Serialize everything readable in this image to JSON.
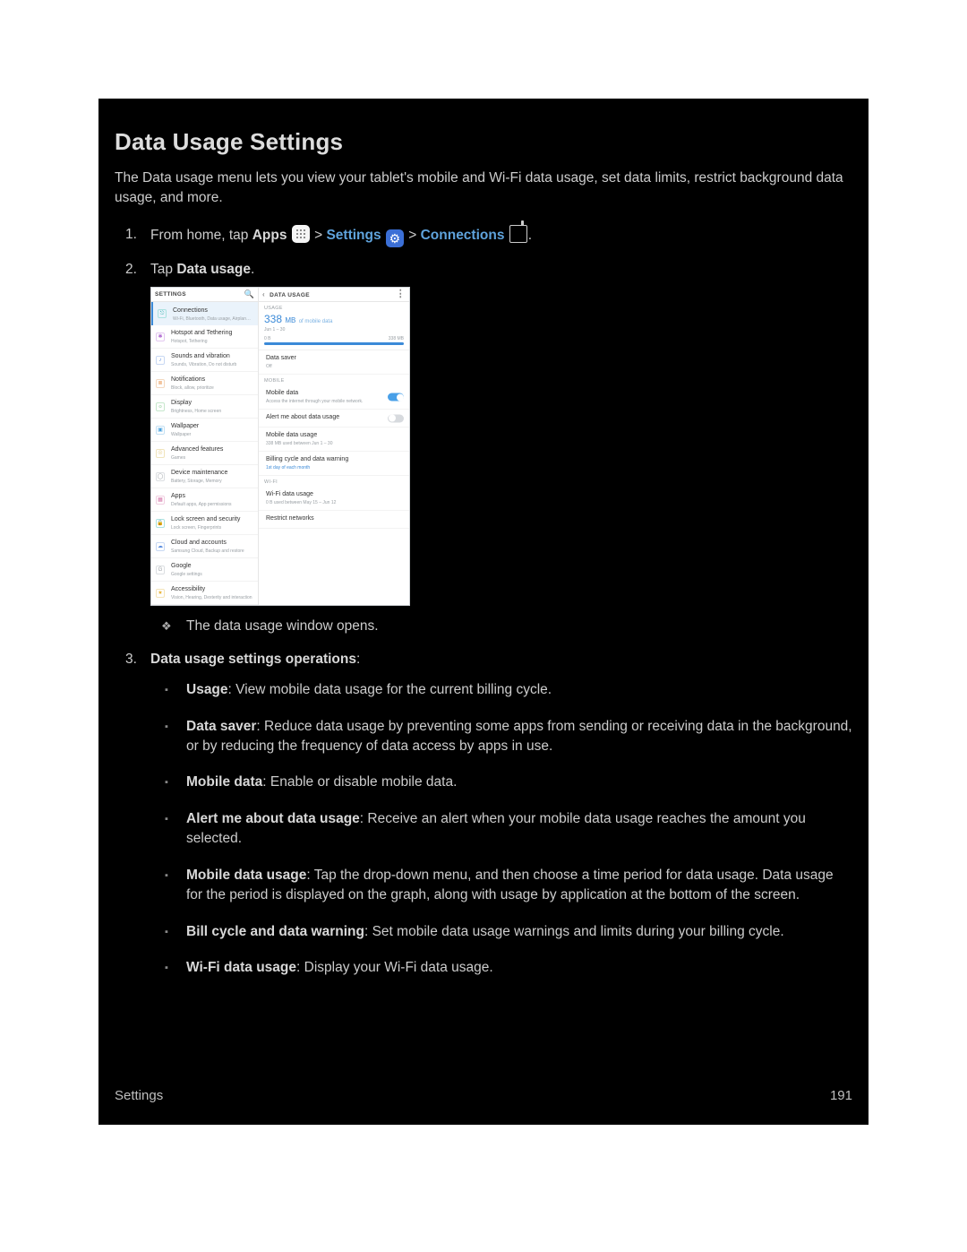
{
  "title": "Data Usage Settings",
  "intro": "The Data usage menu lets you view your tablet's mobile and Wi-Fi data usage, set data limits, restrict background data usage, and more.",
  "steps": {
    "s1": {
      "pre": "From home, tap ",
      "apps": "Apps",
      "settings": "Settings",
      "connections": "Connections",
      "gt": " > "
    },
    "s2": {
      "pre": "Tap ",
      "bold": "Data usage",
      "post": "."
    },
    "resultBullet": "The data usage window opens.",
    "s3": {
      "bold": "Data usage settings operations",
      "post": ":"
    }
  },
  "ops": [
    {
      "b": "Usage",
      "t": ": View mobile data usage for the current billing cycle."
    },
    {
      "b": "Data saver",
      "t": ": Reduce data usage by preventing some apps from sending or receiving data in the background, or by reducing the frequency of data access by apps in use."
    },
    {
      "b": "Mobile data",
      "t": ": Enable or disable mobile data."
    },
    {
      "b": "Alert me about data usage",
      "t": ": Receive an alert when your mobile data usage reaches the amount you selected."
    },
    {
      "b": "Mobile data usage",
      "t": ": Tap the drop-down menu, and then choose a time period for data usage. Data usage for the period is displayed on the graph, along with usage by application at the bottom of the screen."
    },
    {
      "b": "Bill cycle and data warning",
      "t": ": Set mobile data usage warnings and limits during your billing cycle."
    },
    {
      "b": "Wi-Fi data usage",
      "t": ": Display your Wi-Fi data usage."
    }
  ],
  "footer": {
    "left": "Settings",
    "right": "191"
  },
  "shot": {
    "leftHeader": "SETTINGS",
    "rightHeader": "DATA USAGE",
    "leftItems": [
      {
        "t": "Connections",
        "s": "Wi-Fi, Bluetooth, Data usage, Airplane m...",
        "cls": "teal",
        "sel": true,
        "ico": "⎋"
      },
      {
        "t": "Hotspot and Tethering",
        "s": "Hotspot, Tethering",
        "cls": "purple",
        "ico": "✱"
      },
      {
        "t": "Sounds and vibration",
        "s": "Sounds, Vibration, Do not disturb",
        "cls": "blue",
        "ico": "♪"
      },
      {
        "t": "Notifications",
        "s": "Block, allow, prioritize",
        "cls": "orange",
        "ico": "≣"
      },
      {
        "t": "Display",
        "s": "Brightness, Home screen",
        "cls": "green",
        "ico": "☼"
      },
      {
        "t": "Wallpaper",
        "s": "Wallpaper",
        "cls": "cyan",
        "ico": "▣"
      },
      {
        "t": "Advanced features",
        "s": "Games",
        "cls": "gold",
        "ico": "☉"
      },
      {
        "t": "Device maintenance",
        "s": "Battery, Storage, Memory",
        "cls": "gray",
        "ico": "◯"
      },
      {
        "t": "Apps",
        "s": "Default apps, App permissions",
        "cls": "pink",
        "ico": "▦"
      },
      {
        "t": "Lock screen and security",
        "s": "Lock screen, Fingerprints",
        "cls": "teal",
        "ico": "🔒"
      },
      {
        "t": "Cloud and accounts",
        "s": "Samsung Cloud, Backup and restore",
        "cls": "blue",
        "ico": "☁"
      },
      {
        "t": "Google",
        "s": "Google settings",
        "cls": "gray",
        "ico": "G"
      },
      {
        "t": "Accessibility",
        "s": "Vision, Hearing, Dexterity and interaction",
        "cls": "star",
        "ico": "★"
      }
    ],
    "usage": {
      "label": "USAGE",
      "value": "338",
      "unit": "MB",
      "suffix": "of mobile data",
      "period": "Jun 1 – 30",
      "barLeft": "0 B",
      "barRight": "338 MB"
    },
    "rightItems": [
      {
        "t": "Data saver",
        "s": "Off",
        "toggle": null
      },
      {
        "sectionLabel": "MOBILE"
      },
      {
        "t": "Mobile data",
        "s": "Access the internet through your mobile network.",
        "toggle": "on"
      },
      {
        "t": "Alert me about data usage",
        "s": "",
        "toggle": "off"
      },
      {
        "t": "Mobile data usage",
        "s": "338 MB used between Jun 1 – 30",
        "toggle": null
      },
      {
        "t": "Billing cycle and data warning",
        "s": "1st day of each month",
        "accent": true,
        "toggle": null
      },
      {
        "sectionLabel": "WI-FI"
      },
      {
        "t": "Wi-Fi data usage",
        "s": "0 B used between May 15 – Jun 12",
        "toggle": null
      },
      {
        "t": "Restrict networks",
        "s": "",
        "toggle": null
      }
    ]
  }
}
